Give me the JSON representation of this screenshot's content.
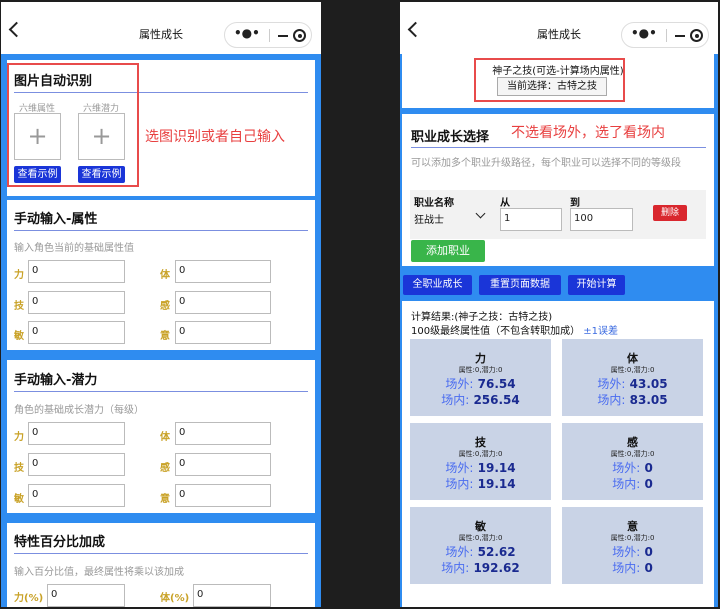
{
  "common": {
    "page_title": "属性成长",
    "capsule_more": "•●•"
  },
  "left": {
    "image_section": {
      "title": "图片自动识别",
      "label_attr": "六维属性",
      "label_potential": "六维潜力",
      "plus": "+",
      "example_btn": "查看示例",
      "note": "选图识别或者自己输入"
    },
    "manual_attr": {
      "title": "手动输入-属性",
      "hint": "输入角色当前的基础属性值",
      "fields": [
        {
          "label": "力",
          "value": "0"
        },
        {
          "label": "体",
          "value": "0"
        },
        {
          "label": "技",
          "value": "0"
        },
        {
          "label": "感",
          "value": "0"
        },
        {
          "label": "敏",
          "value": "0"
        },
        {
          "label": "意",
          "value": "0"
        }
      ]
    },
    "manual_potential": {
      "title": "手动输入-潜力",
      "hint": "角色的基础成长潜力（每级）",
      "fields": [
        {
          "label": "力",
          "value": "0"
        },
        {
          "label": "体",
          "value": "0"
        },
        {
          "label": "技",
          "value": "0"
        },
        {
          "label": "感",
          "value": "0"
        },
        {
          "label": "敏",
          "value": "0"
        },
        {
          "label": "意",
          "value": "0"
        }
      ]
    },
    "trait_bonus": {
      "title": "特性百分比加成",
      "hint": "输入百分比值，最终属性将乘以该加成",
      "fields": [
        {
          "label": "力(%)",
          "value": "0"
        },
        {
          "label": "体(%)",
          "value": "0"
        }
      ]
    }
  },
  "right": {
    "skill": {
      "text": "神子之技(可选-计算场内属性)",
      "current": "当前选择：古特之技"
    },
    "career": {
      "title": "职业成长选择",
      "note": "不选看场外，选了看场内",
      "hint": "可以添加多个职业升级路径，每个职业可以选择不同的等级段",
      "label_name": "职业名称",
      "label_from": "从",
      "label_to": "到",
      "job": "狂战士",
      "from": "1",
      "to": "100",
      "delete_btn": "删除",
      "add_btn": "添加职业"
    },
    "tabs": [
      "全职业成长",
      "重置页面数据",
      "开始计算"
    ],
    "result": {
      "line1": "计算结果:(神子之技：古特之技)",
      "line2": "100级最终属性值（不包含转职加成）",
      "error": "±1误差",
      "outside_label": "场外:",
      "inside_label": "场内:",
      "stats": [
        {
          "name": "力",
          "sub": "属性:0,潜力:0",
          "outside": "76.54",
          "inside": "256.54"
        },
        {
          "name": "体",
          "sub": "属性:0,潜力:0",
          "outside": "43.05",
          "inside": "83.05"
        },
        {
          "name": "技",
          "sub": "属性:0,潜力:0",
          "outside": "19.14",
          "inside": "19.14"
        },
        {
          "name": "感",
          "sub": "属性:0,潜力:0",
          "outside": "0",
          "inside": "0"
        },
        {
          "name": "敏",
          "sub": "属性:0,潜力:0",
          "outside": "52.62",
          "inside": "192.62"
        },
        {
          "name": "意",
          "sub": "属性:0,潜力:0",
          "outside": "0",
          "inside": "0"
        }
      ]
    }
  }
}
